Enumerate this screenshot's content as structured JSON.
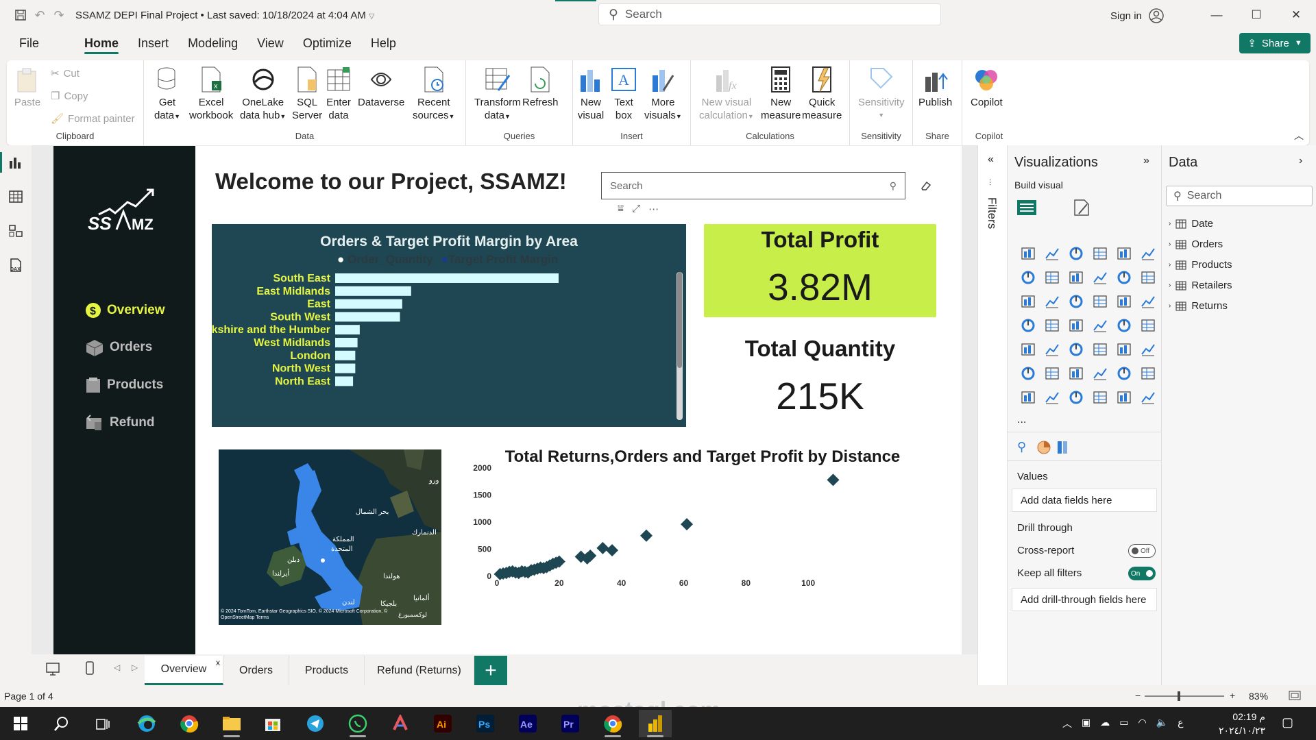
{
  "window": {
    "title": "SSAMZ DEPI Final Project",
    "last_saved": "Last saved: 10/18/2024 at 4:04 AM",
    "search_placeholder": "Search",
    "sign_in": "Sign in"
  },
  "menu": [
    "File",
    "Home",
    "Insert",
    "Modeling",
    "View",
    "Optimize",
    "Help"
  ],
  "share": "Share",
  "ribbon": {
    "clipboard": {
      "paste": "Paste",
      "cut": "Cut",
      "copy": "Copy",
      "format_painter": "Format painter",
      "group": "Clipboard"
    },
    "data": {
      "get_data": [
        "Get",
        "data"
      ],
      "excel": [
        "Excel",
        "workbook"
      ],
      "onelake": [
        "OneLake",
        "data hub"
      ],
      "sql": [
        "SQL",
        "Server"
      ],
      "enter": [
        "Enter",
        "data"
      ],
      "dataverse": [
        "Dataverse",
        ""
      ],
      "recent": [
        "Recent",
        "sources"
      ],
      "group": "Data"
    },
    "queries": {
      "transform": [
        "Transform",
        "data"
      ],
      "refresh": [
        "Refresh",
        ""
      ],
      "group": "Queries"
    },
    "insert": {
      "new_visual": [
        "New",
        "visual"
      ],
      "text_box": [
        "Text",
        "box"
      ],
      "more_visuals": [
        "More",
        "visuals"
      ],
      "group": "Insert"
    },
    "calculations": {
      "new_visual_calc": [
        "New visual",
        "calculation"
      ],
      "new_measure": [
        "New",
        "measure"
      ],
      "quick_measure": [
        "Quick",
        "measure"
      ],
      "group": "Calculations"
    },
    "sensitivity": {
      "label": [
        "Sensitivity",
        ""
      ],
      "group": "Sensitivity"
    },
    "share": {
      "publish": [
        "Publish",
        ""
      ],
      "group": "Share"
    },
    "copilot": {
      "label": [
        "Copilot",
        ""
      ],
      "group": "Copilot"
    }
  },
  "report": {
    "logo_text": "SSAMZ",
    "nav": [
      "Overview",
      "Orders",
      "Products",
      "Refund"
    ],
    "welcome": "Welcome to our Project, SSAMZ!",
    "search_placeholder": "Search",
    "total_profit": {
      "title": "Total Profit",
      "value": "3.82M"
    },
    "total_quantity": {
      "title": "Total Quantity",
      "value": "215K"
    },
    "map_attribution": "© 2024 TomTom, Earthstar Geographics SIO, © 2024 Microsoft Corporation, © OpenStreetMap Terms",
    "map_labels": [
      "بحر الشمال",
      "الدنمارك",
      "المملكة",
      "المتحدة",
      "دبلن",
      "أيرلندا",
      "لندن",
      "هولندا",
      "بلجيكا",
      "ألمانيا",
      "لوكسمبورغ",
      "ورو"
    ]
  },
  "chart_data": [
    {
      "type": "bar",
      "title": "Orders & Target Profit Margin by Area",
      "legend": [
        "Order_Quantity",
        "Target Profit Margin"
      ],
      "categories": [
        "South East",
        "East Midlands",
        "East",
        "South West",
        "Yorkshire and the Humber",
        "West Midlands",
        "London",
        "North West",
        "North East"
      ],
      "series": [
        {
          "name": "Order_Quantity",
          "values": [
            100,
            34,
            30,
            29,
            11,
            10,
            9,
            9,
            8
          ]
        }
      ],
      "colors": {
        "bar": "#d4fbff",
        "label": "#e6f542",
        "background": "#1e4753"
      }
    },
    {
      "type": "scatter",
      "title": "Total Returns,Orders and Target Profit by Distance",
      "xlim": [
        0,
        120
      ],
      "ylim": [
        0,
        2000
      ],
      "xticks": [
        0,
        20,
        40,
        60,
        80,
        100
      ],
      "yticks": [
        0,
        500,
        1000,
        1500,
        2000
      ],
      "points": [
        [
          1,
          40
        ],
        [
          2,
          50
        ],
        [
          3,
          60
        ],
        [
          4,
          80
        ],
        [
          5,
          90
        ],
        [
          6,
          70
        ],
        [
          7,
          60
        ],
        [
          8,
          90
        ],
        [
          9,
          80
        ],
        [
          10,
          70
        ],
        [
          11,
          110
        ],
        [
          12,
          120
        ],
        [
          13,
          140
        ],
        [
          14,
          160
        ],
        [
          15,
          150
        ],
        [
          16,
          170
        ],
        [
          17,
          200
        ],
        [
          18,
          230
        ],
        [
          19,
          250
        ],
        [
          20,
          270
        ],
        [
          27,
          360
        ],
        [
          29,
          330
        ],
        [
          30,
          380
        ],
        [
          34,
          520
        ],
        [
          37,
          480
        ],
        [
          48,
          750
        ],
        [
          61,
          960
        ],
        [
          108,
          1780
        ]
      ],
      "color": "#1e4753"
    }
  ],
  "pages": {
    "tabs": [
      "Overview",
      "Orders",
      "Products",
      "Refund (Returns)"
    ],
    "active": 0,
    "status": "Page 1 of 4",
    "zoom": "83%"
  },
  "filters_label": "Filters",
  "visualizations": {
    "title": "Visualizations",
    "build": "Build visual",
    "values": "Values",
    "add_data": "Add data fields here",
    "drill": "Drill through",
    "cross_report": "Cross-report",
    "cross_state": "Off",
    "keep_filters": "Keep all filters",
    "keep_state": "On",
    "add_drill": "Add drill-through fields here",
    "more": "..."
  },
  "data": {
    "title": "Data",
    "search": "Search",
    "tables": [
      "Date",
      "Orders",
      "Products",
      "Retailers",
      "Returns"
    ]
  },
  "taskbar": {
    "time": "02:19 م",
    "date": "٢٠٢٤/١٠/٢٣",
    "lang": "ع"
  },
  "watermark": "mostaql.com"
}
